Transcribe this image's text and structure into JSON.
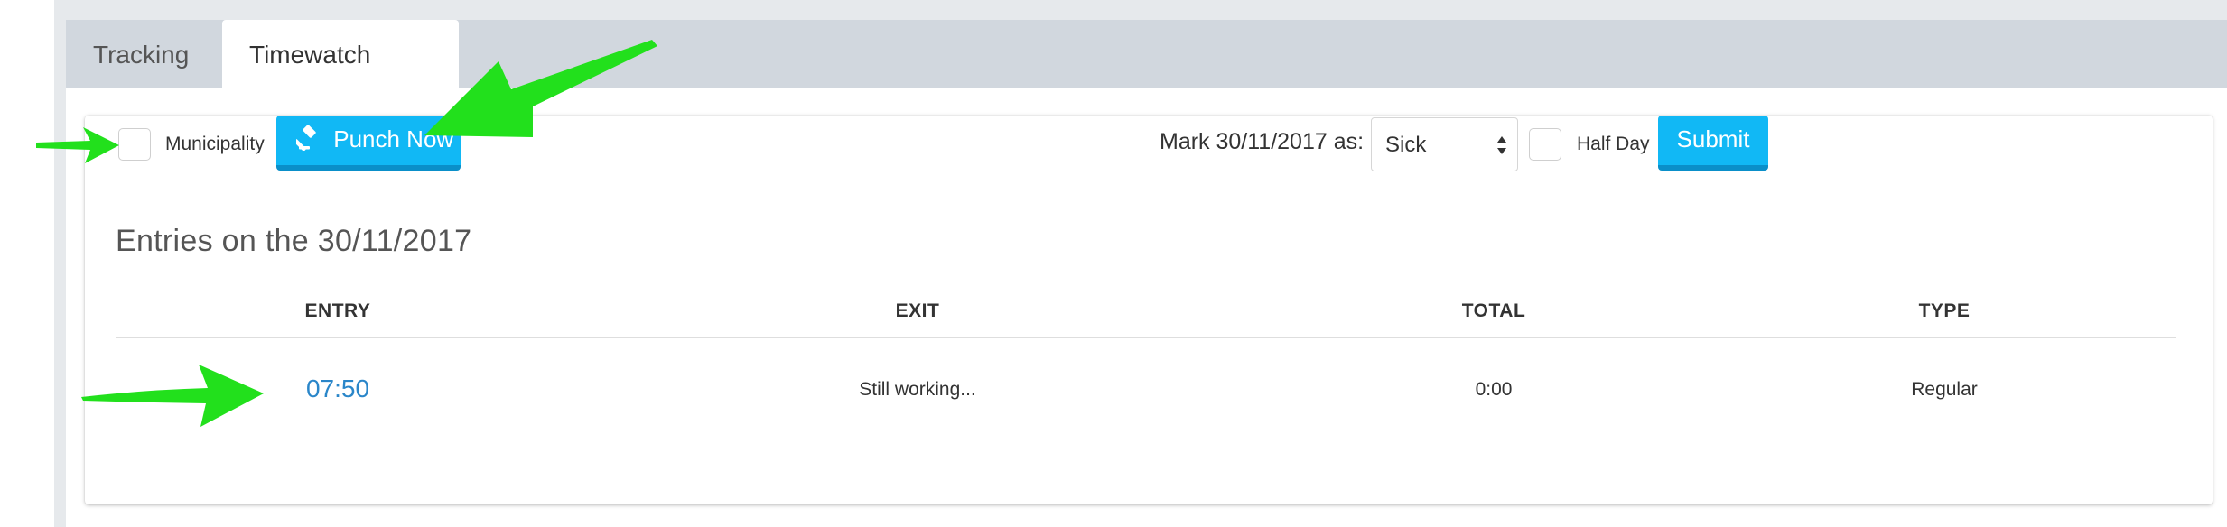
{
  "tabs": [
    {
      "label": "Tracking",
      "active": false
    },
    {
      "label": "Timewatch",
      "active": true
    }
  ],
  "toolbar": {
    "municipality_label": "Municipality",
    "punch_label": "Punch Now",
    "mark_label": "Mark 30/11/2017 as:",
    "mark_select_value": "Sick",
    "half_day_label": "Half Day",
    "submit_label": "Submit"
  },
  "entries": {
    "title": "Entries on the 30/11/2017",
    "columns": [
      "ENTRY",
      "EXIT",
      "TOTAL",
      "TYPE"
    ],
    "rows": [
      {
        "entry": "07:50",
        "exit": "Still working...",
        "total": "0:00",
        "type": "Regular"
      }
    ]
  },
  "colors": {
    "accent_button": "#11b8f5",
    "link": "#2a86c9",
    "annotation_arrow": "#22e01c",
    "tabbar": "#d1d7de"
  },
  "icons": {
    "punch_button_icon": "gavel-icon"
  }
}
